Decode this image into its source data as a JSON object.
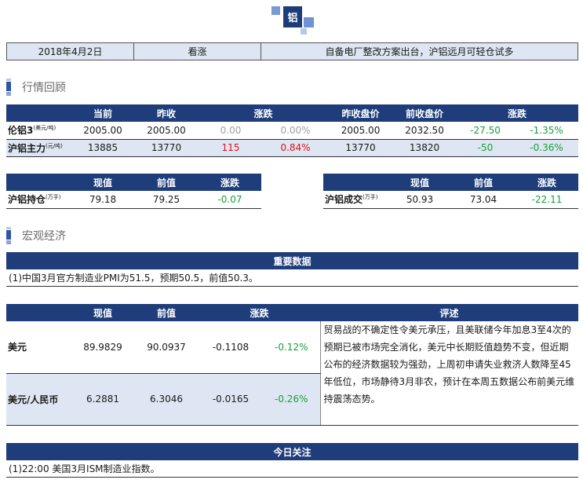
{
  "logo": {
    "char": "铝"
  },
  "headline": {
    "date": "2018年4月2日",
    "view": "看涨",
    "summary": "自备电厂整改方案出台，沪铝远月可轻仓试多"
  },
  "section_market": {
    "title": "行情回顾"
  },
  "price_table": {
    "headers": [
      "",
      "当前",
      "昨收",
      "涨跌",
      "",
      "昨收盘价",
      "前收盘价",
      "涨跌",
      ""
    ],
    "rows": [
      {
        "label": "伦铝3",
        "unit": "(美元/吨)",
        "cur": "2005.00",
        "prev": "2005.00",
        "chg": "0.00",
        "pct": "0.00%",
        "close": "2005.00",
        "prev_close": "2032.50",
        "chg2": "-27.50",
        "pct2": "-1.35%"
      },
      {
        "label": "沪铝主力",
        "unit": "(元/吨)",
        "cur": "13885",
        "prev": "13770",
        "chg": "115",
        "pct": "0.84%",
        "close": "13770",
        "prev_close": "13820",
        "chg2": "-50",
        "pct2": "-0.36%"
      }
    ]
  },
  "position_table": {
    "headers": [
      "",
      "现值",
      "前值",
      "涨跌"
    ],
    "label": "沪铝持仓",
    "unit": "(万手)",
    "cur": "79.18",
    "prev": "79.25",
    "chg": "-0.07"
  },
  "volume_table": {
    "headers": [
      "",
      "现值",
      "前值",
      "涨跌"
    ],
    "label": "沪铝成交",
    "unit": "(万手)",
    "cur": "50.93",
    "prev": "73.04",
    "chg": "-22.11"
  },
  "section_macro": {
    "title": "宏观经济"
  },
  "important_data": {
    "title": "重要数据",
    "text": "(1)中国3月官方制造业PMI为51.5，预期50.5，前值50.3。"
  },
  "fx_table": {
    "headers": [
      "",
      "现值",
      "前值",
      "涨跌",
      "",
      "评述"
    ],
    "rows": [
      {
        "label": "美元",
        "cur": "89.9829",
        "prev": "90.0937",
        "chg": "-0.1108",
        "pct": "-0.12%"
      },
      {
        "label": "美元/人民币",
        "cur": "6.2881",
        "prev": "6.3046",
        "chg": "-0.0165",
        "pct": "-0.26%"
      }
    ],
    "comment": "贸易战的不确定性令美元承压，且美联储今年加息3至4次的预期已被市场完全消化，美元中长期贬值趋势不变，但近期公布的经济数据较为强劲，上周初申请失业救济人数降至45年低位，市场静待3月非农，预计在本周五数据公布前美元维持震荡态势。"
  },
  "today_focus": {
    "title": "今日关注",
    "text": "(1)22:00 美国3月ISM制造业指数。"
  },
  "colors": {
    "header_blue": "#1e3d7a",
    "row_tint": "#dde6f2",
    "up_red": "#e0121a",
    "down_green": "#18a039",
    "flat_grey": "#a0a0a0"
  }
}
